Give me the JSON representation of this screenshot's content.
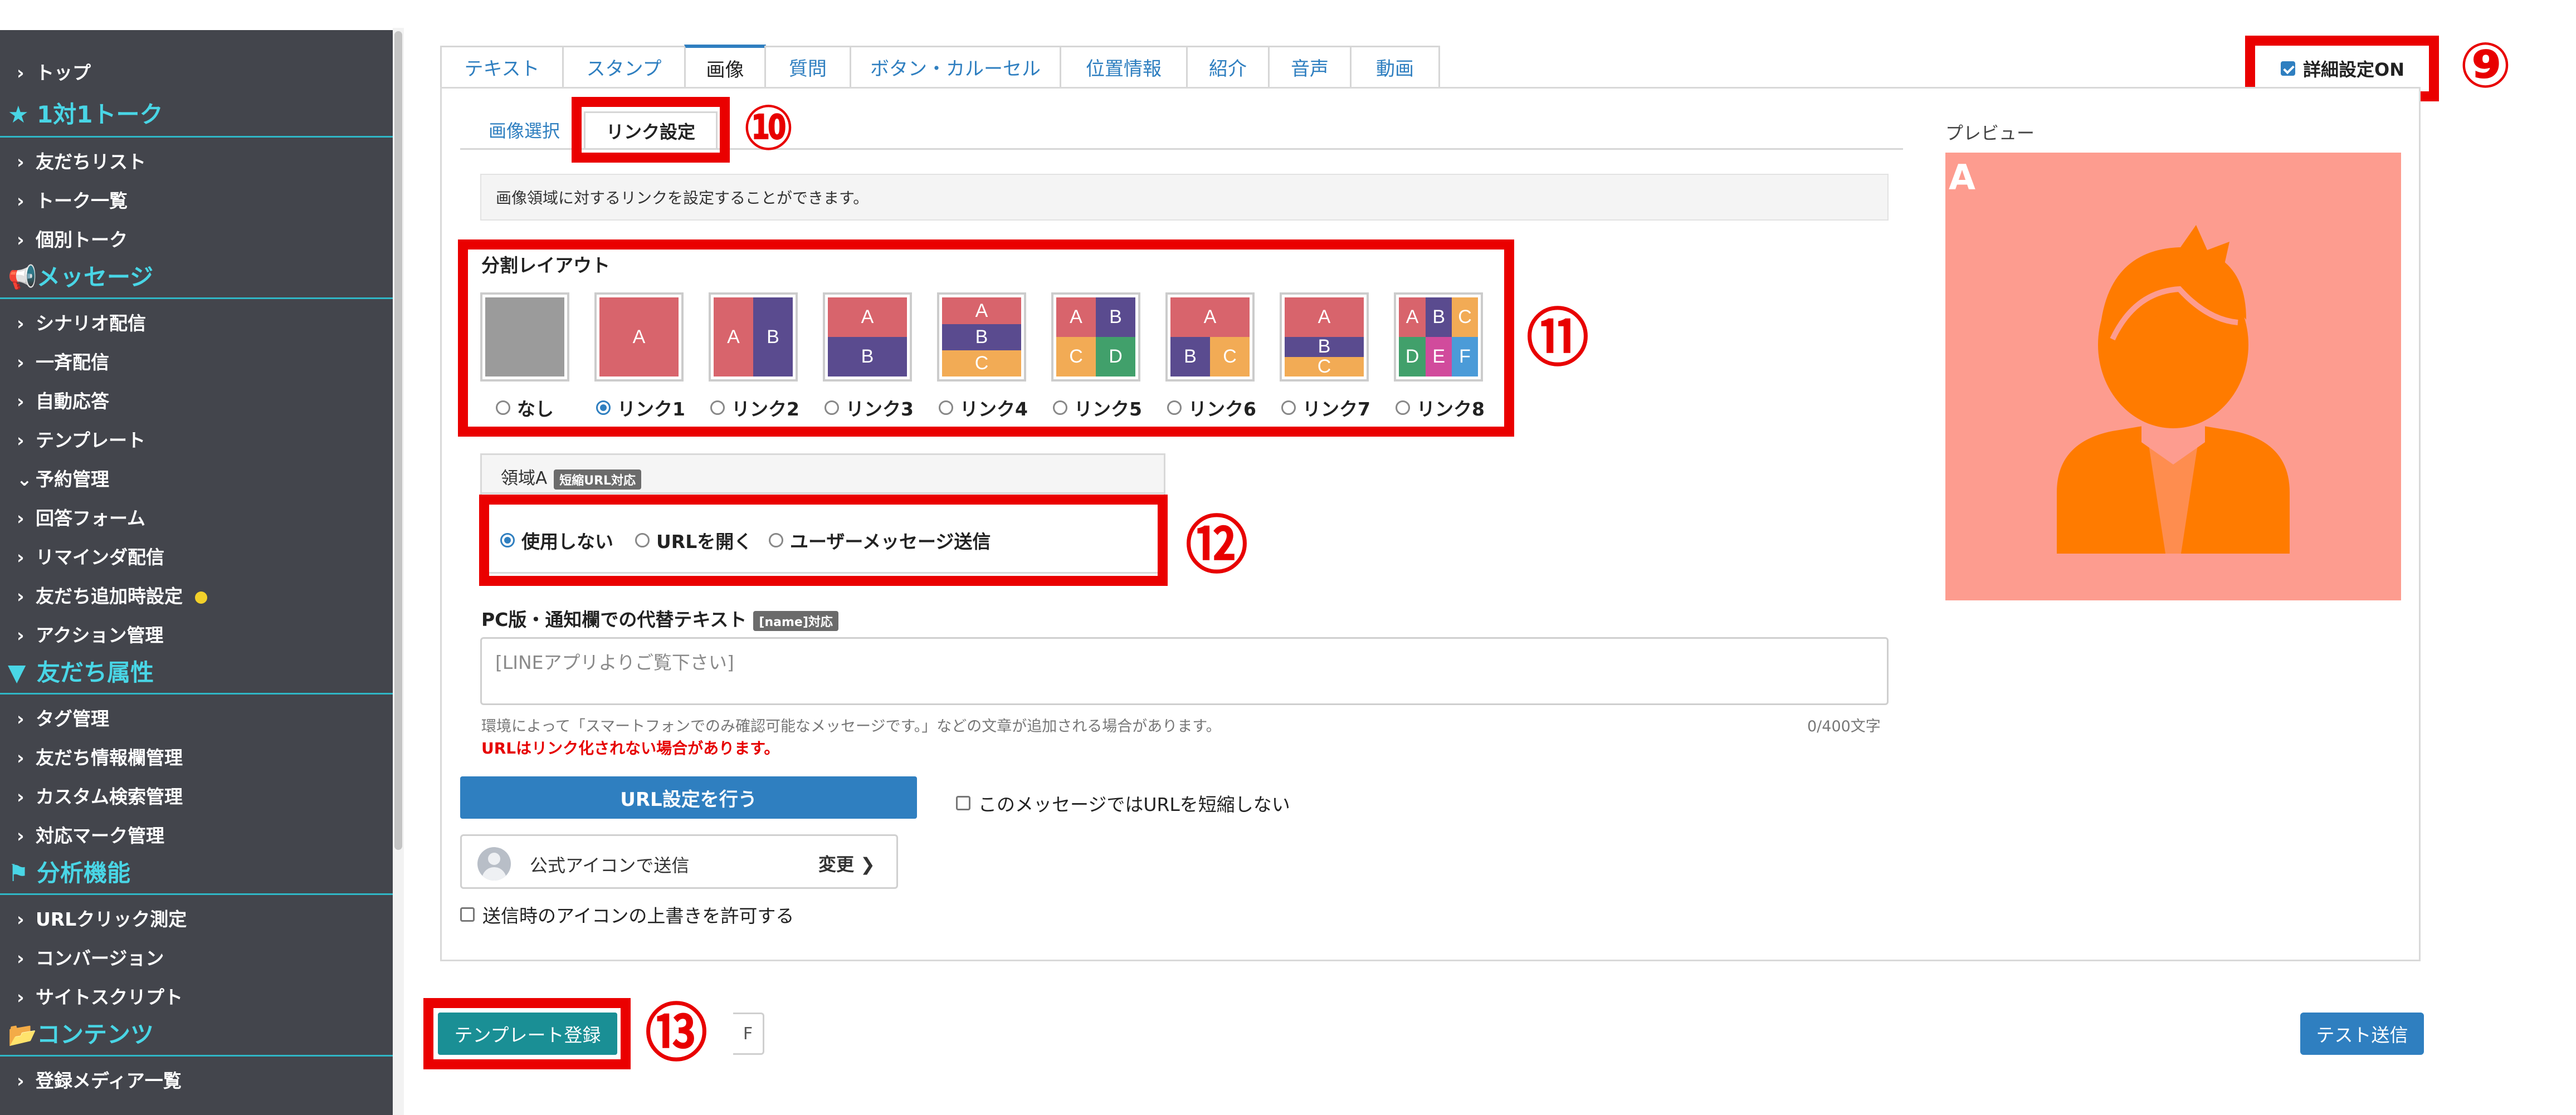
{
  "sidebar": {
    "items": [
      {
        "type": "item",
        "label": "トップ"
      },
      {
        "type": "head",
        "icon": "star-icon",
        "label": "1対1トーク"
      },
      {
        "type": "item",
        "label": "友だちリスト"
      },
      {
        "type": "item",
        "label": "トーク一覧"
      },
      {
        "type": "item",
        "label": "個別トーク"
      },
      {
        "type": "head",
        "icon": "megaphone-icon",
        "label": "メッセージ"
      },
      {
        "type": "item",
        "label": "シナリオ配信"
      },
      {
        "type": "item",
        "label": "一斉配信"
      },
      {
        "type": "item",
        "label": "自動応答"
      },
      {
        "type": "item",
        "label": "テンプレート"
      },
      {
        "type": "item",
        "label": "予約管理",
        "expanded": true
      },
      {
        "type": "item",
        "label": "回答フォーム"
      },
      {
        "type": "item",
        "label": "リマインダ配信"
      },
      {
        "type": "item",
        "label": "友だち追加時設定",
        "dot": true
      },
      {
        "type": "item",
        "label": "アクション管理"
      },
      {
        "type": "head",
        "icon": "filter-icon",
        "label": "友だち属性"
      },
      {
        "type": "item",
        "label": "タグ管理"
      },
      {
        "type": "item",
        "label": "友だち情報欄管理"
      },
      {
        "type": "item",
        "label": "カスタム検索管理"
      },
      {
        "type": "item",
        "label": "対応マーク管理"
      },
      {
        "type": "head",
        "icon": "flag-icon",
        "label": "分析機能"
      },
      {
        "type": "item",
        "label": "URLクリック測定"
      },
      {
        "type": "item",
        "label": "コンバージョン"
      },
      {
        "type": "item",
        "label": "サイトスクリプト"
      },
      {
        "type": "head",
        "icon": "folder-open-icon",
        "label": "コンテンツ"
      },
      {
        "type": "item",
        "label": "登録メディア一覧"
      }
    ]
  },
  "tabs": [
    "テキスト",
    "スタンプ",
    "画像",
    "質問",
    "ボタン・カルーセル",
    "位置情報",
    "紹介",
    "音声",
    "動画"
  ],
  "active_tab": "画像",
  "advanced_toggle": {
    "label": "詳細設定ON",
    "checked": true
  },
  "subtabs": [
    "画像選択",
    "リンク設定"
  ],
  "active_subtab": "リンク設定",
  "description": "画像領域に対するリンクを設定することができます。",
  "layout": {
    "title": "分割レイアウト",
    "options": [
      "なし",
      "リンク1",
      "リンク2",
      "リンク3",
      "リンク4",
      "リンク5",
      "リンク6",
      "リンク7",
      "リンク8"
    ],
    "selected": "リンク1"
  },
  "region": {
    "title": "領域A",
    "badge": "短縮URL対応",
    "options": [
      "使用しない",
      "URLを開く",
      "ユーザーメッセージ送信"
    ],
    "selected": "使用しない"
  },
  "alt_text": {
    "label": "PC版・通知欄での代替テキスト",
    "badge": "[name]対応",
    "placeholder": "[LINEアプリよりご覧下さい]",
    "note": "環境によって「スマートフォンでのみ確認可能なメッセージです。」などの文章が追加される場合があります。",
    "counter": "0/400文字",
    "warning": "URLはリンク化されない場合があります。"
  },
  "url_button": "URL設定を行う",
  "no_shorten": "このメッセージではURLを短縮しない",
  "sender_icon": {
    "label": "公式アイコンで送信",
    "change": "変更"
  },
  "allow_icon_override": "送信時のアイコンの上書きを許可する",
  "preview": {
    "label": "プレビュー",
    "region_letter": "A",
    "bg_color": "#fd9c8f",
    "figure_color": "#ff7b00"
  },
  "footer": {
    "template_button": "テンプレート登録",
    "partial_text": "F",
    "test_send": "テスト送信"
  },
  "annotations": [
    "⑨",
    "⑩",
    "⑪",
    "⑫",
    "⑬"
  ],
  "thumb_letters": {
    "a": "A",
    "b": "B",
    "c": "C",
    "d": "D",
    "e": "E",
    "f": "F"
  }
}
